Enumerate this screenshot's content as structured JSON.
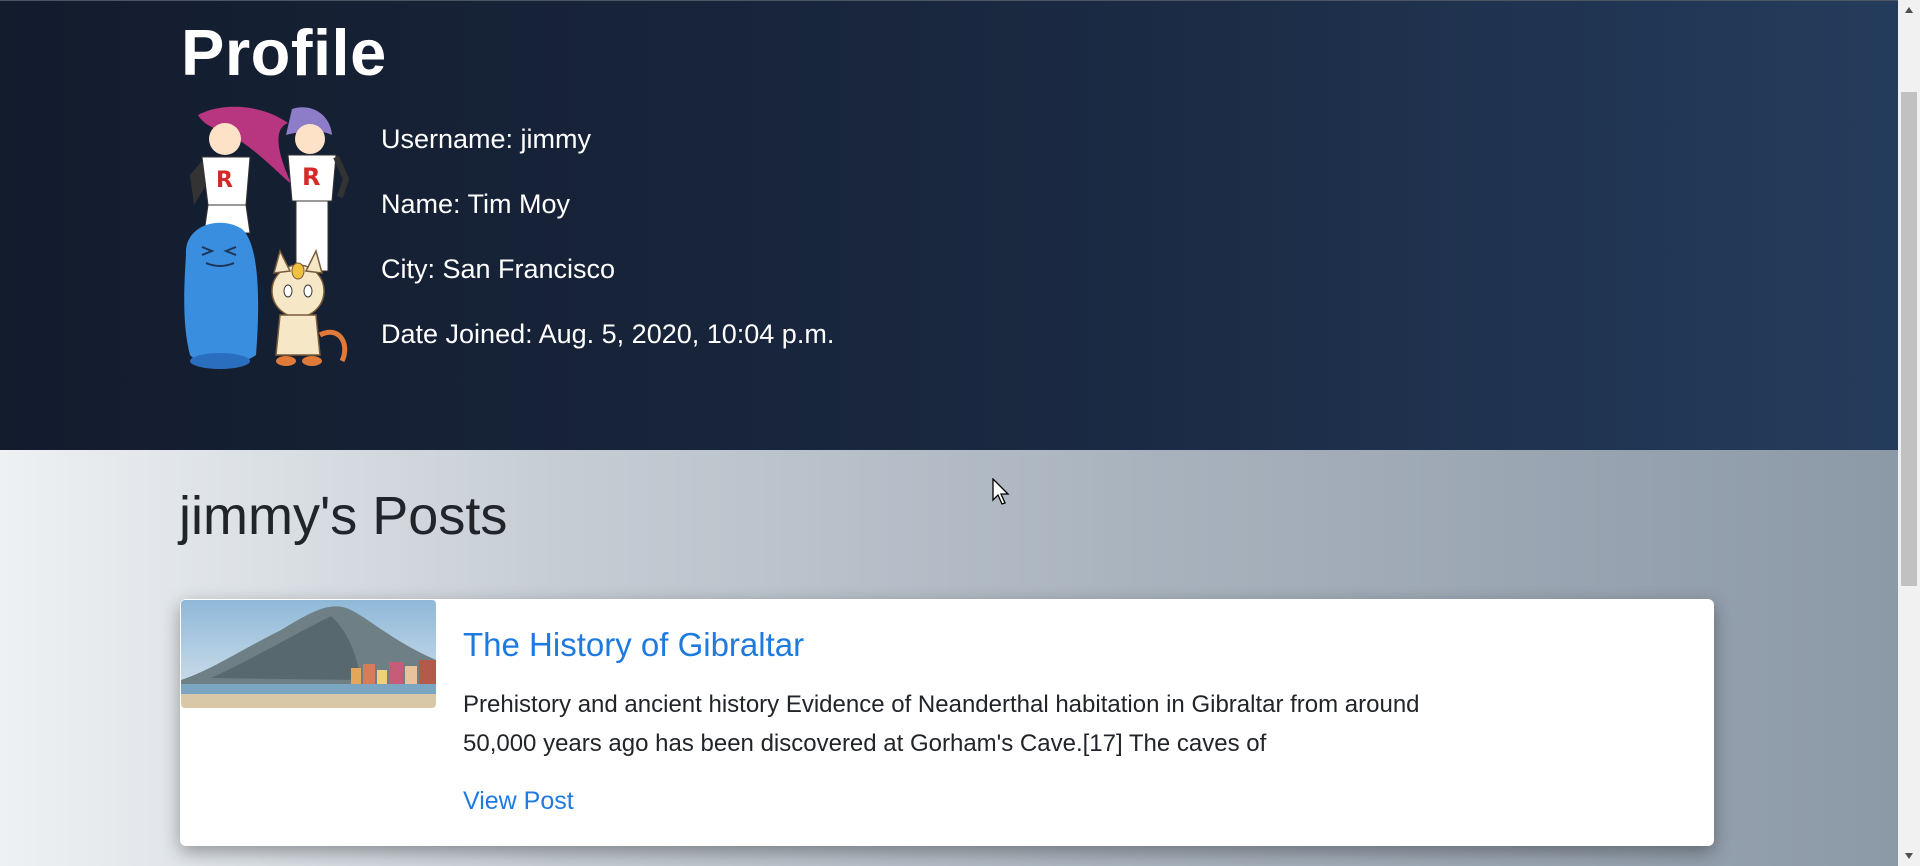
{
  "profile": {
    "title": "Profile",
    "avatar_icon": "team-rocket-avatar",
    "username": "Username: jimmy",
    "name": "Name: Tim Moy",
    "city": "City: San Francisco",
    "date_joined": "Date Joined: Aug. 5, 2020, 10:04 p.m."
  },
  "posts": {
    "heading": "jimmy's Posts",
    "items": [
      {
        "title": "The History of Gibraltar",
        "excerpt": "Prehistory and ancient history Evidence of Neanderthal habitation in Gibraltar from around 50,000 years ago has been discovered at Gorham's Cave.[17] The caves of",
        "link_label": "View Post",
        "thumbnail_icon": "gibraltar-rock-image"
      }
    ]
  },
  "colors": {
    "hero_bg": "#1a2841",
    "link": "#1f7ae0",
    "text_dark": "#212529"
  }
}
